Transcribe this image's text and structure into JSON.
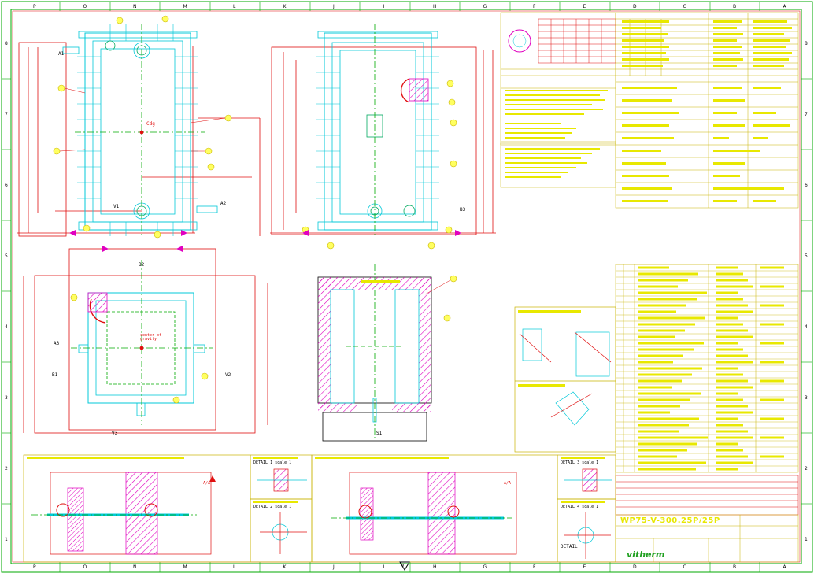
{
  "sheet": {
    "zones_top": [
      "P",
      "O",
      "N",
      "M",
      "L",
      "K",
      "J",
      "I",
      "H",
      "G",
      "F",
      "E",
      "D",
      "C",
      "B",
      "A"
    ],
    "zones_bottom": [
      "P",
      "O",
      "N",
      "M",
      "L",
      "K",
      "J",
      "I",
      "H",
      "G",
      "F",
      "E",
      "D",
      "C",
      "B",
      "A"
    ],
    "rows": [
      "8",
      "7",
      "6",
      "5",
      "4",
      "3",
      "2",
      "1"
    ]
  },
  "annotations": {
    "cog_label": "Cdg",
    "center_gravity": "center of gravity",
    "nozzle_a1": "A1",
    "nozzle_a2": "A2",
    "nozzle_a3": "A3",
    "nozzle_b1": "B1",
    "nozzle_b2": "B2",
    "nozzle_b3": "B3",
    "nozzle_v1": "V1",
    "nozzle_v2": "V2",
    "nozzle_v3": "V3",
    "nozzle_s1": "S1",
    "axis_aa": "A/A",
    "detail_1": "DETAIL 1  scale 1",
    "detail_2": "DETAIL 2  scale 1",
    "detail_3": "DETAIL 3  scale 1",
    "detail_4": "DETAIL 4  scale 1"
  },
  "title_block": {
    "drawing_no": "WP75-V-300.25P/25P",
    "company": "vitherm",
    "detail_label": "DETAIL",
    "v_marker": "V"
  },
  "colors": {
    "frame": "#00aa00",
    "cyan": "#00c8d8",
    "red": "#e01010",
    "magenta": "#e000c0",
    "yellow": "#e0e000",
    "dark": "#000000"
  }
}
